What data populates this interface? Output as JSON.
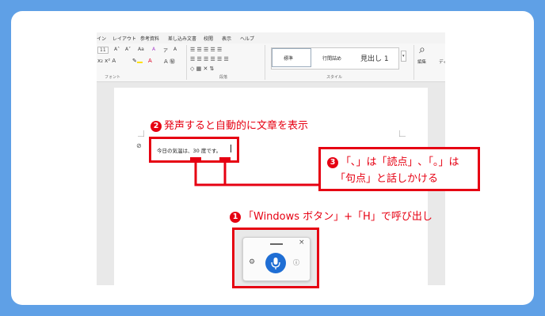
{
  "menu": [
    "イン",
    "レイアウト",
    "参考資料",
    "差し込み文書",
    "校閲",
    "表示",
    "ヘルプ"
  ],
  "ribbon": {
    "font_size": "11",
    "font_tools": [
      "A˄",
      "A˅",
      "Aa",
      "A",
      "ア",
      "A"
    ],
    "groups": {
      "font": "フォント",
      "paragraph": "段落",
      "style": "スタイル"
    },
    "styles": [
      "標準",
      "行間詰め",
      "見出し 1"
    ],
    "edit_label": "編集",
    "dictate_label": "ディ"
  },
  "document": {
    "text": "今日の気温は、30 度です。"
  },
  "annotations": {
    "step2": {
      "num": "2",
      "text": "発声すると自動的に文章を表示"
    },
    "step3": {
      "num": "3",
      "line1": "「､」は「読点」､「｡」は",
      "line2": "「句点」と話しかける"
    },
    "step1": {
      "num": "1",
      "text": "「Windows ボタン」+「H」で呼び出し"
    }
  },
  "voice_panel": {
    "close": "×",
    "settings_icon": "gear-icon",
    "mic_icon": "microphone-icon",
    "help_icon": "help-icon"
  },
  "colors": {
    "accent_red": "#e60012",
    "background_blue": "#5fa0e6",
    "mic_blue": "#1f6ed4"
  }
}
